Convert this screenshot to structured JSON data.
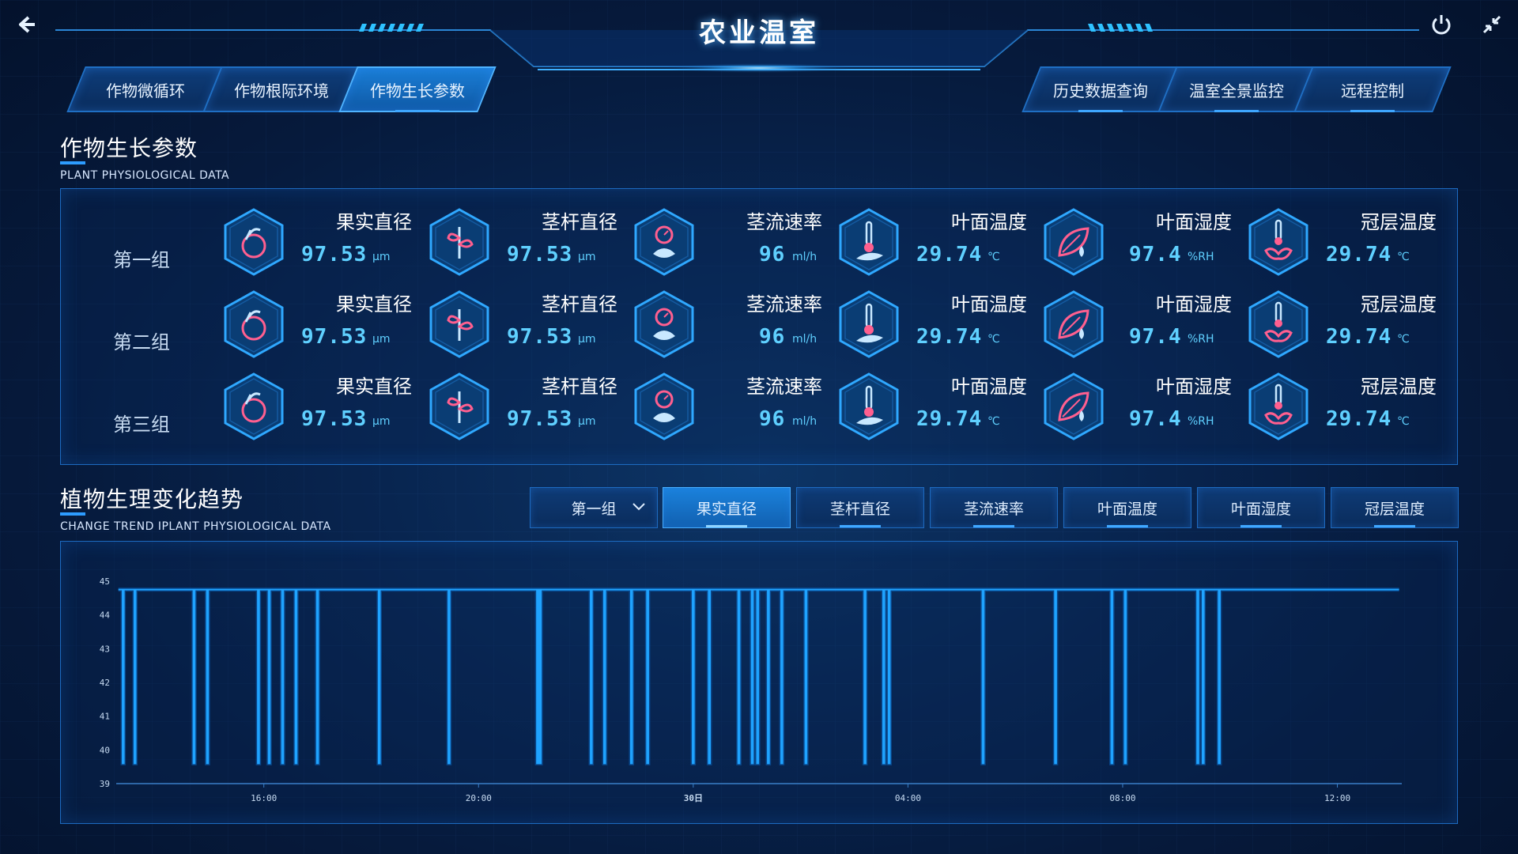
{
  "header": {
    "title": "农业温室",
    "back_icon": "back-arrow-icon",
    "power_icon": "power-icon",
    "collapse_icon": "collapse-icon"
  },
  "tabs_left": [
    {
      "label": "作物微循环",
      "active": false
    },
    {
      "label": "作物根际环境",
      "active": false
    },
    {
      "label": "作物生长参数",
      "active": true
    }
  ],
  "tabs_right": [
    {
      "label": "历史数据查询",
      "active": false
    },
    {
      "label": "温室全景监控",
      "active": false
    },
    {
      "label": "远程控制",
      "active": false
    }
  ],
  "section_growth": {
    "title": "作物生长参数",
    "subtitle": "PLANT PHYSIOLOGICAL DATA"
  },
  "groups": [
    {
      "label": "第一组",
      "metrics": [
        {
          "name": "果实直径",
          "value": "97.53",
          "unit": "μm",
          "icon": "fruit-icon"
        },
        {
          "name": "茎杆直径",
          "value": "97.53",
          "unit": "μm",
          "icon": "stem-icon"
        },
        {
          "name": "茎流速率",
          "value": "96",
          "unit": "ml/h",
          "icon": "sap-flow-icon"
        },
        {
          "name": "叶面温度",
          "value": "29.74",
          "unit": "℃",
          "icon": "leaf-temperature-icon"
        },
        {
          "name": "叶面湿度",
          "value": "97.4",
          "unit": "%RH",
          "icon": "leaf-humidity-icon"
        },
        {
          "name": "冠层温度",
          "value": "29.74",
          "unit": "℃",
          "icon": "canopy-temperature-icon"
        }
      ]
    },
    {
      "label": "第二组",
      "metrics": [
        {
          "name": "果实直径",
          "value": "97.53",
          "unit": "μm",
          "icon": "fruit-icon"
        },
        {
          "name": "茎杆直径",
          "value": "97.53",
          "unit": "μm",
          "icon": "stem-icon"
        },
        {
          "name": "茎流速率",
          "value": "96",
          "unit": "ml/h",
          "icon": "sap-flow-icon"
        },
        {
          "name": "叶面温度",
          "value": "29.74",
          "unit": "℃",
          "icon": "leaf-temperature-icon"
        },
        {
          "name": "叶面湿度",
          "value": "97.4",
          "unit": "%RH",
          "icon": "leaf-humidity-icon"
        },
        {
          "name": "冠层温度",
          "value": "29.74",
          "unit": "℃",
          "icon": "canopy-temperature-icon"
        }
      ]
    },
    {
      "label": "第三组",
      "metrics": [
        {
          "name": "果实直径",
          "value": "97.53",
          "unit": "μm",
          "icon": "fruit-icon"
        },
        {
          "name": "茎杆直径",
          "value": "97.53",
          "unit": "μm",
          "icon": "stem-icon"
        },
        {
          "name": "茎流速率",
          "value": "96",
          "unit": "ml/h",
          "icon": "sap-flow-icon"
        },
        {
          "name": "叶面温度",
          "value": "29.74",
          "unit": "℃",
          "icon": "leaf-temperature-icon"
        },
        {
          "name": "叶面湿度",
          "value": "97.4",
          "unit": "%RH",
          "icon": "leaf-humidity-icon"
        },
        {
          "name": "冠层温度",
          "value": "29.74",
          "unit": "℃",
          "icon": "canopy-temperature-icon"
        }
      ]
    }
  ],
  "section_trend": {
    "title": "植物生理变化趋势",
    "subtitle": "CHANGE TREND IPLANT PHYSIOLOGICAL DATA"
  },
  "filter": {
    "group_select": "第一组",
    "metric_buttons": [
      {
        "label": "果实直径",
        "active": true
      },
      {
        "label": "茎杆直径",
        "active": false
      },
      {
        "label": "茎流速率",
        "active": false
      },
      {
        "label": "叶面温度",
        "active": false
      },
      {
        "label": "叶面湿度",
        "active": false
      },
      {
        "label": "冠层温度",
        "active": false
      }
    ]
  },
  "colors": {
    "accent": "#2d9cff",
    "value_text": "#5fd0ff",
    "series_line": "#1fa3ff",
    "icon_pink": "#ff5f8f"
  },
  "chart_data": {
    "type": "line",
    "title": "",
    "xlabel": "",
    "ylabel": "",
    "ylim": [
      39,
      45
    ],
    "yticks": [
      "39",
      "40",
      "41",
      "42",
      "43",
      "44",
      "45"
    ],
    "xticks": [
      "16:00",
      "20:00",
      "30日",
      "04:00",
      "08:00",
      "12:00"
    ],
    "xtick_hours": [
      16,
      20,
      24,
      28,
      32,
      36
    ],
    "xlim_hours": [
      13.25,
      37.2
    ],
    "grid": false,
    "series": [
      {
        "baseline": 44.75,
        "min": 39.6,
        "drop_hours": [
          13.38,
          13.6,
          14.7,
          14.95,
          15.9,
          16.1,
          16.35,
          16.6,
          17.0,
          18.15,
          19.45,
          21.1,
          21.15,
          22.1,
          22.35,
          22.85,
          23.15,
          24.0,
          24.3,
          24.85,
          25.1,
          25.2,
          25.4,
          25.65,
          26.1,
          27.2,
          27.55,
          27.65,
          29.4,
          30.75,
          31.8,
          32.05,
          33.4,
          33.5,
          33.8
        ]
      }
    ]
  }
}
